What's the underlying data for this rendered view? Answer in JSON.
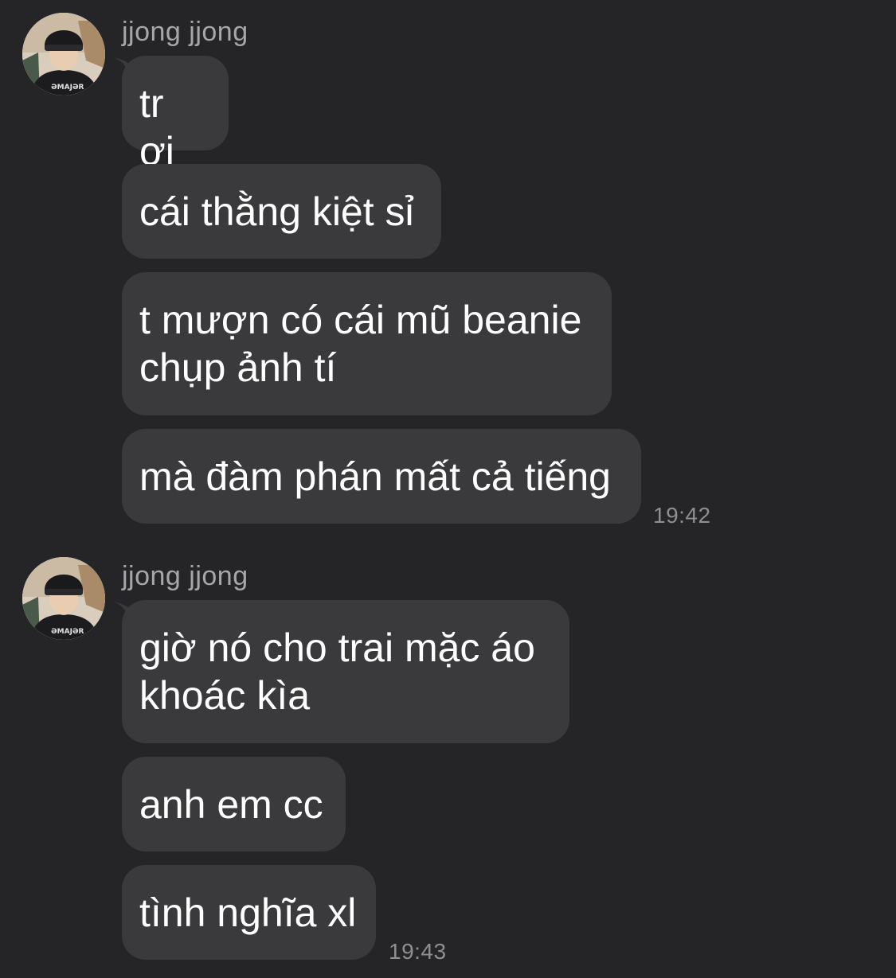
{
  "chat": {
    "groups": [
      {
        "sender": "jjong jjong",
        "messages": [
          {
            "text": "tr ơi"
          },
          {
            "text": "cái thằng kiệt sỉ"
          },
          {
            "text": "t mượn có cái mũ beanie\nchụp ảnh tí"
          },
          {
            "text": "mà đàm phán mất cả tiếng"
          }
        ],
        "time": "19:42"
      },
      {
        "sender": "jjong jjong",
        "messages": [
          {
            "text": "giờ nó cho trai mặc áo\nkhoác kìa"
          },
          {
            "text": "anh em cc"
          },
          {
            "text": "tình nghĩa xl"
          }
        ],
        "time": "19:43"
      }
    ]
  },
  "colors": {
    "background": "#252527",
    "bubble": "#3a3a3c",
    "text": "#ffffff",
    "sender": "#a6a6ab",
    "timestamp": "#8e8e93"
  },
  "icons": {
    "avatar": "profile-photo"
  }
}
